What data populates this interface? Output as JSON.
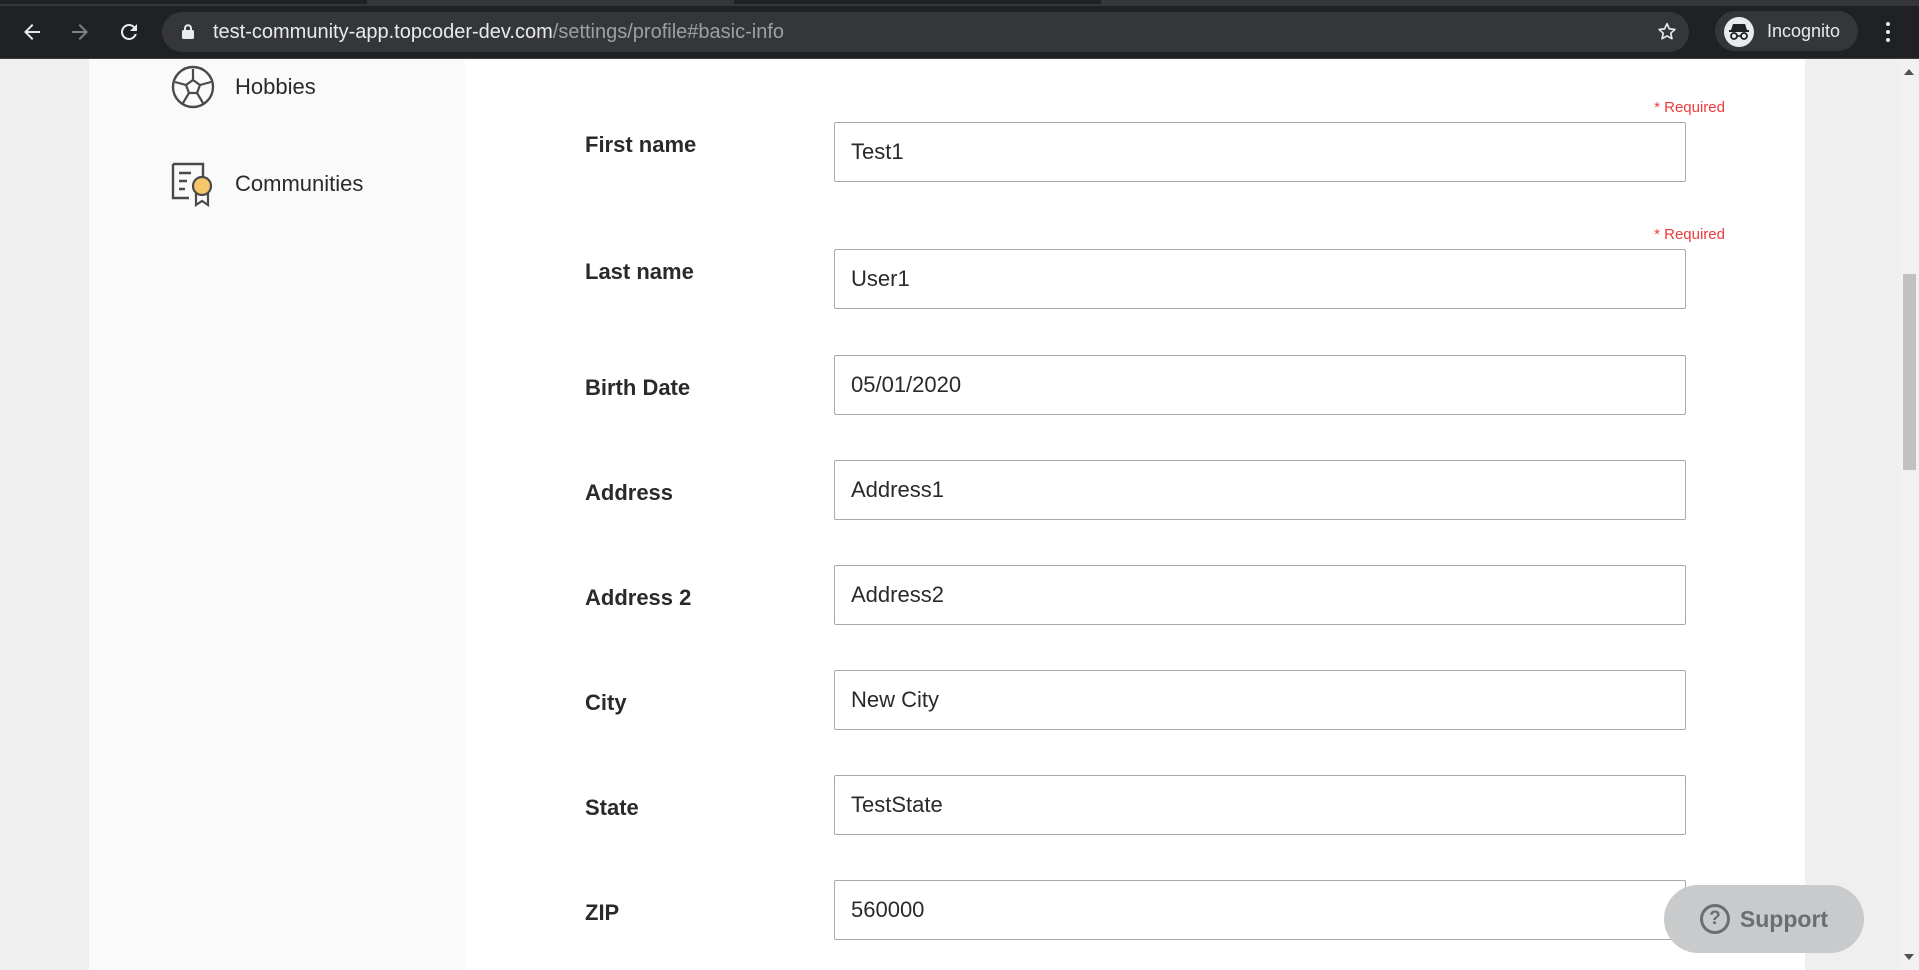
{
  "browser": {
    "url_host": "test-community-app.topcoder-dev.com",
    "url_path": "/settings/profile#basic-info",
    "profile_label": "Incognito"
  },
  "sidebar": {
    "items": [
      {
        "label": "Hobbies",
        "icon": "hobbies-soccer-ball-icon"
      },
      {
        "label": "Communities",
        "icon": "communities-certificate-icon"
      }
    ]
  },
  "form": {
    "required_text": "* Required",
    "fields": [
      {
        "label": "First name",
        "value": "Test1"
      },
      {
        "label": "Last name",
        "value": "User1"
      },
      {
        "label": "Birth Date",
        "value": "05/01/2020"
      },
      {
        "label": "Address",
        "value": "Address1"
      },
      {
        "label": "Address 2",
        "value": "Address2"
      },
      {
        "label": "City",
        "value": "New City"
      },
      {
        "label": "State",
        "value": "TestState"
      },
      {
        "label": "ZIP",
        "value": "560000"
      }
    ]
  },
  "support": {
    "label": "Support",
    "icon": "question-icon"
  },
  "colors": {
    "required": "#ef3a3a",
    "chrome_bg": "#202124",
    "accent_icon": "#f6c66b"
  }
}
